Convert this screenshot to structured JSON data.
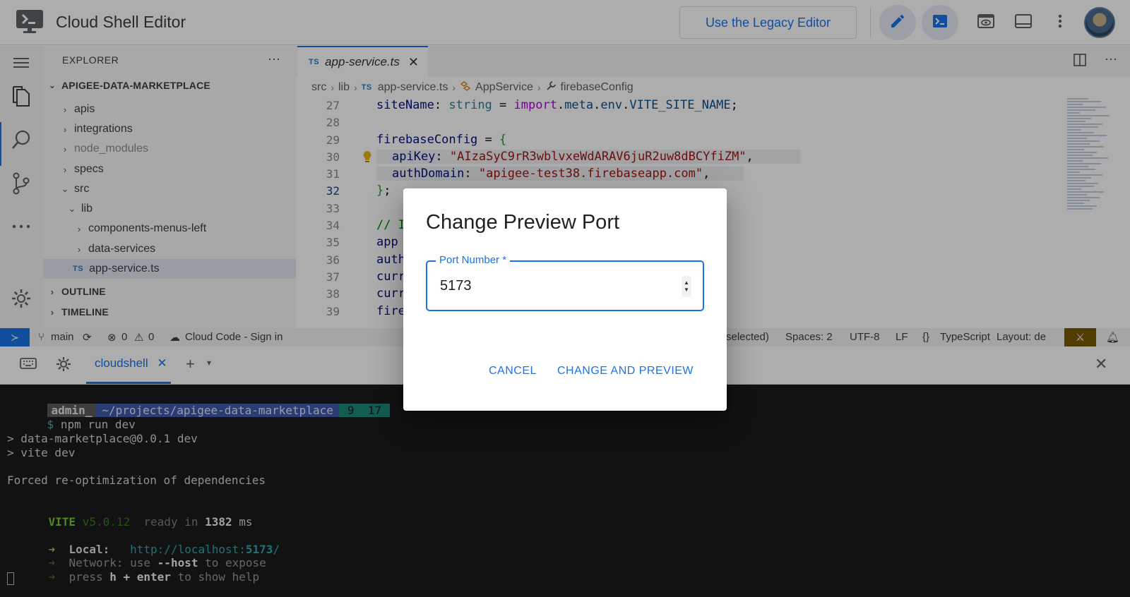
{
  "app": {
    "title": "Cloud Shell Editor",
    "legacy_button": "Use the Legacy Editor",
    "accent": "#1a73e8"
  },
  "topbar_icons": [
    "pencil-icon",
    "terminal-icon",
    "preview-icon",
    "panel-toggle-icon",
    "more-vert-icon"
  ],
  "explorer": {
    "title": "EXPLORER",
    "project": "APIGEE-DATA-MARKETPLACE",
    "items": [
      {
        "label": "apis"
      },
      {
        "label": "integrations"
      },
      {
        "label": "node_modules"
      },
      {
        "label": "specs"
      },
      {
        "label": "src"
      },
      {
        "label": "lib"
      },
      {
        "label": "components-menus-left"
      },
      {
        "label": "data-services"
      },
      {
        "label": "app-service.ts",
        "badge": "TS"
      }
    ],
    "sections": {
      "outline": "OUTLINE",
      "timeline": "TIMELINE"
    }
  },
  "editor": {
    "tab": {
      "badge": "TS",
      "label": "app-service.ts"
    },
    "breadcrumb": {
      "src": "src",
      "lib": "lib",
      "badge": "TS",
      "file": "app-service.ts",
      "cls": "AppService",
      "member": "firebaseConfig"
    },
    "line_numbers": [
      "27",
      "28",
      "29",
      "30",
      "31",
      "32",
      "33",
      "34",
      "35",
      "36",
      "37",
      "38",
      "39"
    ],
    "code": {
      "l27": {
        "a": "siteName",
        "b": ": ",
        "c": "string",
        "d": " = ",
        "e": "import",
        "f": ".",
        "g": "meta",
        "h": ".",
        "i": "env",
        "j": ".",
        "k": "VITE_SITE_NAME",
        "l": ";"
      },
      "l29": {
        "a": "firebaseConfig",
        "b": " = ",
        "c": "{"
      },
      "l30": {
        "a": "apiKey",
        "b": ": ",
        "c": "\"AIzaSyC9rR3wblvxeWdARAV6juR2uw8dBCYfiZM\"",
        "d": ","
      },
      "l31": {
        "a": "authDomain",
        "b": ": ",
        "c": "\"apigee-test38.firebaseapp.com\"",
        "d": ","
      },
      "l32": {
        "a": "}",
        "b": ";"
      },
      "l34": "// I",
      "l35": "app",
      "l36": "auth",
      "l37": "curr",
      "l38": "curr",
      "l39": "fire"
    }
  },
  "statusbar": {
    "branch": "main",
    "errors": "0",
    "warnings": "0",
    "cloud_code": "Cloud Code - Sign in",
    "selected": "selected)",
    "spaces": "Spaces: 2",
    "encoding": "UTF-8",
    "eol": "LF",
    "lang_braces": "{}",
    "language": "TypeScript",
    "layout": "Layout: de"
  },
  "terminal": {
    "tab_label": "cloudshell",
    "prompt": {
      "user": "admin_",
      "path": "~/projects/apigee-data-marketplace",
      "git": "9  17"
    },
    "dollar": "$",
    "command": "npm run dev",
    "out1": "> data-marketplace@0.0.1 dev",
    "out2": "> vite dev",
    "out3": "Forced re-optimization of dependencies",
    "vite": "VITE",
    "vite_ver": "v5.0.12",
    "ready": "ready in",
    "ready_ms": "1382",
    "ms": "ms",
    "arrow": "➜",
    "local_label": "Local:",
    "local_url_a": "http://localhost:",
    "local_url_port": "5173",
    "local_url_b": "/",
    "network_label": "Network",
    "network_a": ": use ",
    "network_flag": "--host",
    "network_b": " to expose",
    "help_a": "press ",
    "help_key": "h + enter",
    "help_b": " to show help"
  },
  "dialog": {
    "title": "Change Preview Port",
    "field_label": "Port Number *",
    "port_value": "5173",
    "cancel": "CANCEL",
    "confirm": "CHANGE AND PREVIEW"
  }
}
